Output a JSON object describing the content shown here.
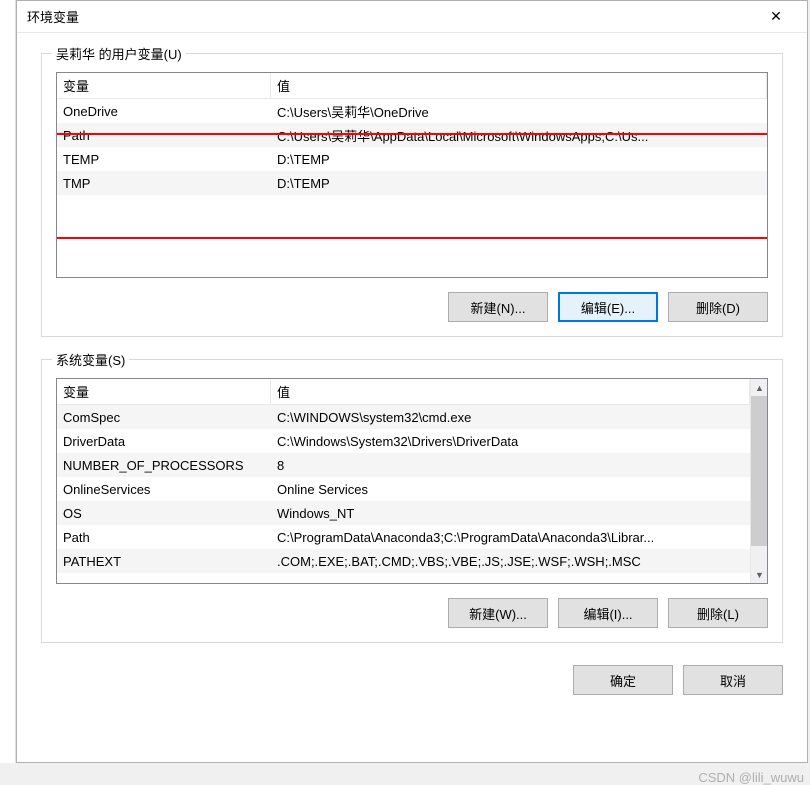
{
  "titlebar": {
    "title": "环境变量"
  },
  "user_vars": {
    "group_label": "吴莉华 的用户变量(U)",
    "columns": {
      "var": "变量",
      "val": "值"
    },
    "rows": [
      {
        "var": "OneDrive",
        "val": "C:\\Users\\吴莉华\\OneDrive"
      },
      {
        "var": "Path",
        "val": "C:\\Users\\吴莉华\\AppData\\Local\\Microsoft\\WindowsApps;C:\\Us..."
      },
      {
        "var": "TEMP",
        "val": "D:\\TEMP"
      },
      {
        "var": "TMP",
        "val": "D:\\TEMP"
      }
    ],
    "buttons": {
      "new": "新建(N)...",
      "edit": "编辑(E)...",
      "delete": "删除(D)"
    }
  },
  "system_vars": {
    "group_label": "系统变量(S)",
    "columns": {
      "var": "变量",
      "val": "值"
    },
    "rows": [
      {
        "var": "ComSpec",
        "val": "C:\\WINDOWS\\system32\\cmd.exe"
      },
      {
        "var": "DriverData",
        "val": "C:\\Windows\\System32\\Drivers\\DriverData"
      },
      {
        "var": "NUMBER_OF_PROCESSORS",
        "val": "8"
      },
      {
        "var": "OnlineServices",
        "val": "Online Services"
      },
      {
        "var": "OS",
        "val": "Windows_NT"
      },
      {
        "var": "Path",
        "val": "C:\\ProgramData\\Anaconda3;C:\\ProgramData\\Anaconda3\\Librar..."
      },
      {
        "var": "PATHEXT",
        "val": ".COM;.EXE;.BAT;.CMD;.VBS;.VBE;.JS;.JSE;.WSF;.WSH;.MSC"
      }
    ],
    "buttons": {
      "new": "新建(W)...",
      "edit": "编辑(I)...",
      "delete": "删除(L)"
    }
  },
  "dialog_buttons": {
    "ok": "确定",
    "cancel": "取消"
  },
  "watermark": "CSDN @lili_wuwu"
}
